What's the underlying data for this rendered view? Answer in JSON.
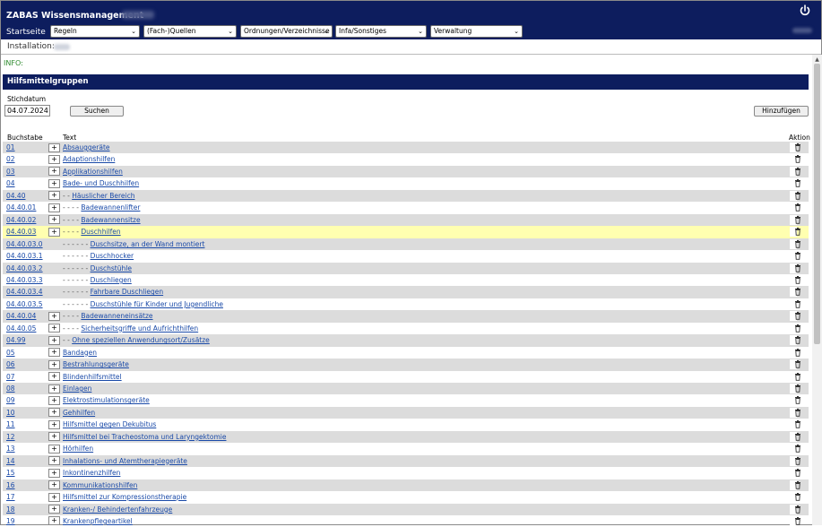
{
  "app": {
    "title": "ZABAS Wissensmanagement"
  },
  "nav": {
    "start_label": "Startseite",
    "menus": [
      "Regeln",
      "(Fach-)Quellen",
      "Ordnungen/Verzeichnisse",
      "Infa/Sonstiges",
      "Verwaltung"
    ]
  },
  "installation": {
    "label": "Installation:"
  },
  "info": {
    "label": "INFO:"
  },
  "section": {
    "title": "Hilfsmittelgruppen"
  },
  "search": {
    "date_label": "Stichdatum",
    "date_value": "04.07.2024",
    "search_button": "Suchen",
    "add_button": "Hinzufügen"
  },
  "table": {
    "headers": {
      "code": "Buchstabe",
      "text": "Text",
      "action": "Aktion"
    },
    "rows": [
      {
        "code": "01",
        "text": "Absauggeräte",
        "dash": "",
        "plus": true
      },
      {
        "code": "02",
        "text": "Adaptionshilfen",
        "dash": "",
        "plus": true
      },
      {
        "code": "03",
        "text": "Applikationshilfen",
        "dash": "",
        "plus": true
      },
      {
        "code": "04",
        "text": "Bade- und Duschhilfen",
        "dash": "",
        "plus": true
      },
      {
        "code": "04.40",
        "text": "Häuslicher Bereich",
        "dash": "- -",
        "plus": true
      },
      {
        "code": "04.40.01",
        "text": "Badewannenlifter",
        "dash": "- - - -",
        "plus": true
      },
      {
        "code": "04.40.02",
        "text": "Badewannensitze",
        "dash": "- - - -",
        "plus": true
      },
      {
        "code": "04.40.03",
        "text": "Duschhilfen",
        "dash": "- - - -",
        "plus": true,
        "highlight": true
      },
      {
        "code": "04.40.03.0",
        "text": "Duschsitze, an der Wand montiert",
        "dash": "- - - - - -",
        "plus": false
      },
      {
        "code": "04.40.03.1",
        "text": "Duschhocker",
        "dash": "- - - - - -",
        "plus": false
      },
      {
        "code": "04.40.03.2",
        "text": "Duschstühle",
        "dash": "- - - - - -",
        "plus": false
      },
      {
        "code": "04.40.03.3",
        "text": "Duschliegen",
        "dash": "- - - - - -",
        "plus": false
      },
      {
        "code": "04.40.03.4",
        "text": "Fahrbare Duschliegen",
        "dash": "- - - - - -",
        "plus": false
      },
      {
        "code": "04.40.03.5",
        "text": "Duschstühle für Kinder und Jugendliche",
        "dash": "- - - - - -",
        "plus": false
      },
      {
        "code": "04.40.04",
        "text": "Badewanneneinsätze",
        "dash": "- - - -",
        "plus": true
      },
      {
        "code": "04.40.05",
        "text": "Sicherheitsgriffe und Aufrichthilfen",
        "dash": "- - - -",
        "plus": true
      },
      {
        "code": "04.99",
        "text": "Ohne speziellen Anwendungsort/Zusätze",
        "dash": "- -",
        "plus": true
      },
      {
        "code": "05",
        "text": "Bandagen",
        "dash": "",
        "plus": true
      },
      {
        "code": "06",
        "text": "Bestrahlungsgeräte",
        "dash": "",
        "plus": true
      },
      {
        "code": "07",
        "text": "Blindenhilfsmittel",
        "dash": "",
        "plus": true
      },
      {
        "code": "08",
        "text": "Einlagen",
        "dash": "",
        "plus": true
      },
      {
        "code": "09",
        "text": "Elektrostimulationsgeräte",
        "dash": "",
        "plus": true
      },
      {
        "code": "10",
        "text": "Gehhilfen",
        "dash": "",
        "plus": true
      },
      {
        "code": "11",
        "text": "Hilfsmittel gegen Dekubitus",
        "dash": "",
        "plus": true
      },
      {
        "code": "12",
        "text": "Hilfsmittel bei Tracheostoma und Laryngektomie",
        "dash": "",
        "plus": true
      },
      {
        "code": "13",
        "text": "Hörhilfen",
        "dash": "",
        "plus": true
      },
      {
        "code": "14",
        "text": "Inhalations- und Atemtherapiegeräte",
        "dash": "",
        "plus": true
      },
      {
        "code": "15",
        "text": "Inkontinenzhilfen",
        "dash": "",
        "plus": true
      },
      {
        "code": "16",
        "text": "Kommunikationshilfen",
        "dash": "",
        "plus": true
      },
      {
        "code": "17",
        "text": "Hilfsmittel zur Kompressionstherapie",
        "dash": "",
        "plus": true
      },
      {
        "code": "18",
        "text": "Kranken-/ Behindertenfahrzeuge",
        "dash": "",
        "plus": true
      },
      {
        "code": "19",
        "text": "Krankenpflegeartikel",
        "dash": "",
        "plus": true
      }
    ]
  }
}
